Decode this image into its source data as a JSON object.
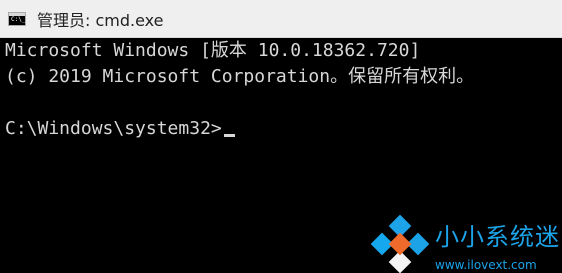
{
  "window": {
    "title": "管理员: cmd.exe"
  },
  "console": {
    "lines": [
      "Microsoft Windows [版本 10.0.18362.720]",
      "(c) 2019 Microsoft Corporation。保留所有权利。"
    ],
    "prompt": "C:\\Windows\\system32>"
  },
  "watermark": {
    "brand": "小小系统迷",
    "url": "www.ilovext.com"
  },
  "icons": {
    "app": "command-prompt-icon",
    "watermark": "diamond-logo-icon"
  },
  "colors": {
    "console_background": "#000000",
    "console_text": "#d7d7d7",
    "titlebar_background": "#efefef",
    "watermark_blue": "#1ca3e8",
    "watermark_orange": "#ef6b2b"
  }
}
